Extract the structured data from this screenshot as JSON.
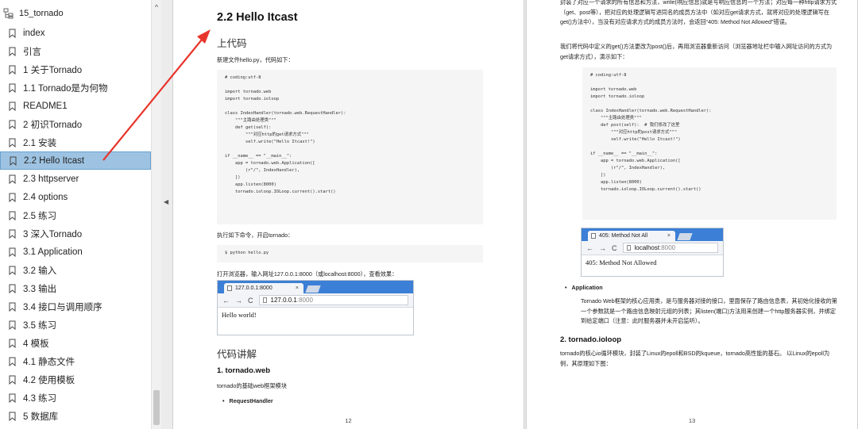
{
  "sidebar": {
    "title": "15_tornado",
    "items": [
      {
        "label": "index"
      },
      {
        "label": "引言"
      },
      {
        "label": "1 关于Tornado"
      },
      {
        "label": "1.1 Tornado是为何物"
      },
      {
        "label": "README1"
      },
      {
        "label": "2 初识Tornado"
      },
      {
        "label": "2.1 安装"
      },
      {
        "label": "2.2 Hello Itcast"
      },
      {
        "label": "2.3 httpserver"
      },
      {
        "label": "2.4 options"
      },
      {
        "label": "2.5 练习"
      },
      {
        "label": "3 深入Tornado"
      },
      {
        "label": "3.1 Application"
      },
      {
        "label": "3.2 输入"
      },
      {
        "label": "3.3 输出"
      },
      {
        "label": "3.4 接口与调用顺序"
      },
      {
        "label": "3.5 练习"
      },
      {
        "label": "4 模板"
      },
      {
        "label": "4.1 静态文件"
      },
      {
        "label": "4.2 使用模板"
      },
      {
        "label": "4.3 练习"
      },
      {
        "label": "5 数据库"
      }
    ],
    "active_index": 7
  },
  "page1": {
    "heading": "2.2 Hello Itcast",
    "section_code": "上代码",
    "intro": "新建文件hello.py，代码如下：",
    "code1": "# coding:utf-8\n\nimport tornado.web\nimport tornado.ioloop\n\nclass IndexHandler(tornado.web.RequestHandler):\n    \"\"\"主路由处理类\"\"\"\n    def get(self):\n        \"\"\"对应http的get请求方式\"\"\"\n        self.write(\"Hello Itcast!\")\n\nif __name__ == \"__main__\":\n    app = tornado.web.Application([\n        (r\"/\", IndexHandler),\n    ])\n    app.listen(8000)\n    tornado.ioloop.IOLoop.current().start()",
    "run_text": "执行如下命令，开启tornado：",
    "code2": "$ python hello.py",
    "open_text": "打开浏览器，输入网址127.0.0.1:8000（或localhost:8000），查看效果：",
    "browser": {
      "tab": "127.0.0.1:8000",
      "host": "127.0.0.1",
      "port": ":8000",
      "body": "Hello world!",
      "close": "×"
    },
    "section_explain": "代码讲解",
    "sub1": "1. tornado.web",
    "sub1_text": "tornado的基础web框架模块",
    "bullet1": "RequestHandler",
    "page_number": "12"
  },
  "page2": {
    "top_text": "封装了对应一个请求的所有信息和方法，write(响应信息)就是写响应信息的一个方法；对应每一种http请求方式（get、post等），把对应的处理逻辑写进同名的成员方法中（如对应get请求方式，就将对应的处理逻辑写在get()方法中），当没有对应请求方式的成员方法时，会返回“405: Method Not Allowed”错误。",
    "post_text": "我们将代码中定义的get()方法更改为post()后，再用浏览器重新访问（浏览器地址栏中输入网址访问的方式为get请求方式），演示如下：",
    "code1": "# coding:utf-8\n\nimport tornado.web\nimport tornado.ioloop\n\nclass IndexHandler(tornado.web.RequestHandler):\n    \"\"\"主路由处理类\"\"\"\n    def post(self):  # 我们修改了这里\n        \"\"\"对应http的post请求方式\"\"\"\n        self.write(\"Hello Itcast!\")\n\nif __name__ == \"__main__\":\n    app = tornado.web.Application([\n        (r\"/\", IndexHandler),\n    ])\n    app.listen(8000)\n    tornado.ioloop.IOLoop.current().start()",
    "browser": {
      "tab": "405: Method Not All",
      "host": "localhost",
      "port": ":8000",
      "body": "405: Method Not Allowed",
      "close": "×"
    },
    "bullet1": "Application",
    "app_text": "Tornado Web框架的核心应用类，是与服务器对接的接口，里面保存了路由信息表，其初始化接收的第一个参数就是一个路由信息映射元组的列表；其listen(端口)方法用来创建一个http服务器实例，并绑定到给定端口（注意：此时服务器并未开启监听）。",
    "sub2": "2. tornado.ioloop",
    "ioloop_text": "tornado的核心io循环模块，封装了Linux的epoll和BSD的kqueue，tornado高性能的基石。 以Linux的epoll为例，其原理如下图：",
    "page_number": "13"
  },
  "colors": {
    "accent_red": "#e8352c",
    "active_bg": "#9ec3e2",
    "tab_bar": "#3b7fd6"
  }
}
